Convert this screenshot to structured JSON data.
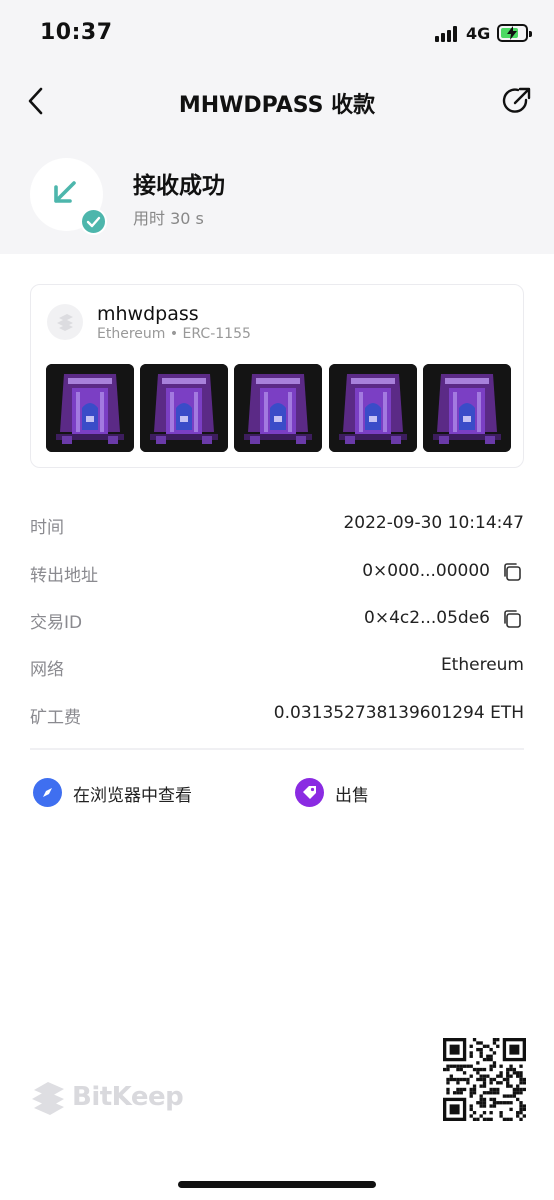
{
  "status_bar": {
    "time": "10:37",
    "network": "4G"
  },
  "nav": {
    "title": "MHWDPASS 收款"
  },
  "receipt": {
    "title": "接收成功",
    "subtitle": "用时 30 s"
  },
  "collection": {
    "name": "mhwdpass",
    "meta": "Ethereum • ERC-1155",
    "thumbnails": [
      "nft-1",
      "nft-2",
      "nft-3",
      "nft-4",
      "nft-5"
    ]
  },
  "details": [
    {
      "label": "时间",
      "value": "2022-09-30 10:14:47",
      "copyable": false
    },
    {
      "label": "转出地址",
      "value": "0×000...00000",
      "copyable": true
    },
    {
      "label": "交易ID",
      "value": "0×4c2...05de6",
      "copyable": true
    },
    {
      "label": "网络",
      "value": "Ethereum",
      "copyable": false
    },
    {
      "label": "矿工费",
      "value": "0.031352738139601294 ETH",
      "copyable": false
    }
  ],
  "actions": {
    "browser": "在浏览器中查看",
    "sell": "出售"
  },
  "footer": {
    "brand": "BitKeep"
  },
  "colors": {
    "accent": "#4db6ac",
    "browser_icon": "#3f6ff0",
    "sell_icon": "#8a2be2"
  }
}
